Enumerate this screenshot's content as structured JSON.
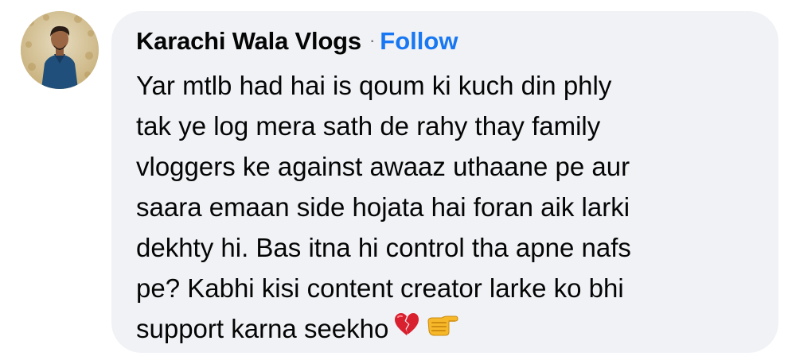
{
  "comment": {
    "author": "Karachi Wala Vlogs",
    "separator": "·",
    "follow_label": "Follow",
    "lines": [
      "Yar mtlb had hai is qoum ki kuch din phly",
      "tak ye log mera sath de rahy thay family",
      "vloggers ke against awaaz uthaane pe aur",
      "saara emaan side hojata hai foran aik larki",
      "dekhty hi. Bas itna hi control tha apne nafs",
      "pe? Kabhi kisi content creator larke ko bhi",
      "support karna seekho"
    ],
    "emojis": [
      "broken-heart-icon",
      "backhand-index-pointing-right-icon"
    ]
  },
  "colors": {
    "bubble_bg": "#f0f2f5",
    "text": "#050505",
    "link": "#1877f2",
    "muted": "#65676b",
    "broken_heart": "#d9202f"
  }
}
